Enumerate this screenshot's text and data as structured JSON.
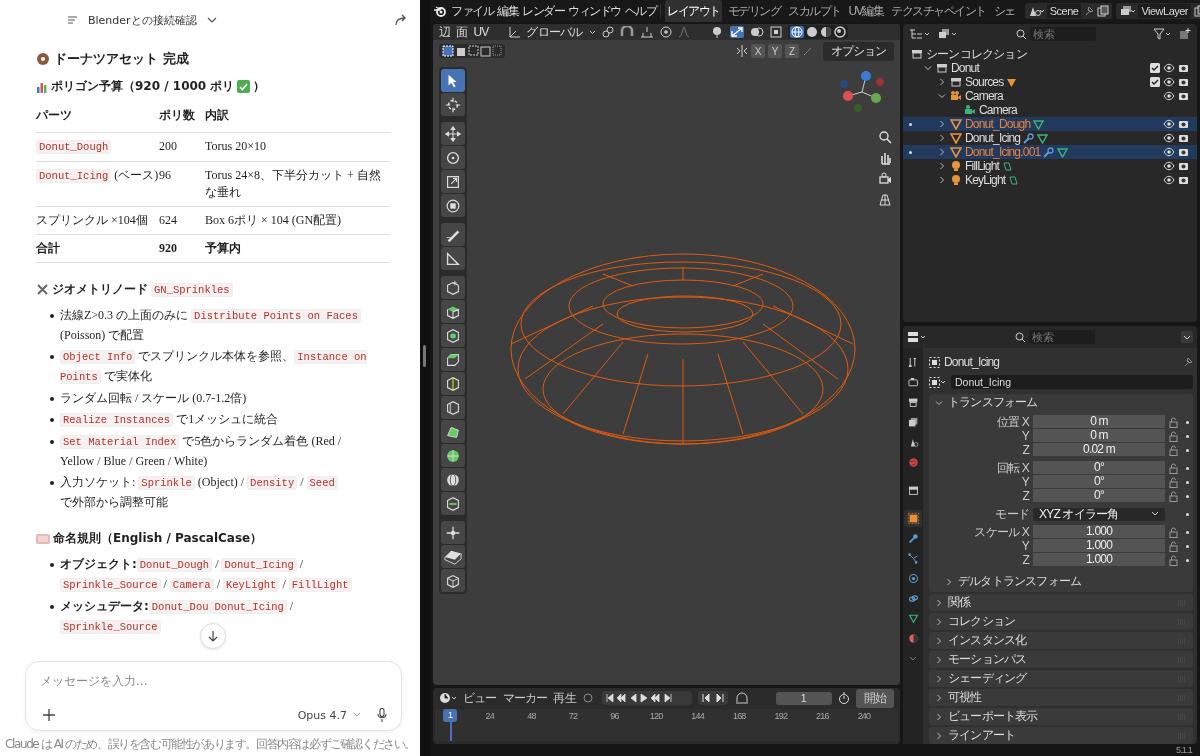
{
  "chat": {
    "title": "Blenderとの接続確認",
    "heading": "ドーナツアセット 完成",
    "budget": {
      "text": "ポリゴン予算（920 / 1000 ポリ",
      "text_after": "）"
    },
    "table": {
      "columns": [
        "パーツ",
        "ポリ数",
        "内訳"
      ],
      "rows": [
        {
          "bold": false,
          "cells": [
            [
              {
                "kind": "code",
                "text": "Donut_Dough"
              }
            ],
            [
              {
                "kind": "text",
                "text": "200"
              }
            ],
            [
              {
                "kind": "text",
                "text": "Torus 20×10"
              }
            ]
          ]
        },
        {
          "bold": false,
          "cells": [
            [
              {
                "kind": "code",
                "text": "Donut_Icing"
              },
              {
                "kind": "text",
                "text": " (ベース)"
              }
            ],
            [
              {
                "kind": "text",
                "text": "96"
              }
            ],
            [
              {
                "kind": "text",
                "text": "Torus 24×8、下半分カット + 自然な垂れ"
              }
            ]
          ]
        },
        {
          "bold": false,
          "cells": [
            [
              {
                "kind": "text",
                "text": "スプリンクル ×104個"
              }
            ],
            [
              {
                "kind": "text",
                "text": "624"
              }
            ],
            [
              {
                "kind": "text",
                "text": "Box 6ポリ × 104 (GN配置)"
              }
            ]
          ]
        },
        {
          "bold": true,
          "cells": [
            [
              {
                "kind": "text",
                "text": "合計"
              }
            ],
            [
              {
                "kind": "text",
                "text": "920"
              }
            ],
            [
              {
                "kind": "text",
                "text": "予算内"
              }
            ]
          ]
        }
      ]
    },
    "sections": [
      {
        "title": "ジオメトリノード",
        "title_code": "GN_Sprinkles",
        "items": [
          [
            {
              "kind": "text",
              "text": "法線Z>0.3 の上面のみに "
            },
            {
              "kind": "code",
              "text": "Distribute Points on Faces"
            },
            {
              "kind": "text",
              "text": " (Poisson) で配置"
            }
          ],
          [
            {
              "kind": "code",
              "text": "Object Info"
            },
            {
              "kind": "text",
              "text": " でスプリンクル本体を参照、"
            },
            {
              "kind": "code",
              "text": "Instance on Points"
            },
            {
              "kind": "text",
              "text": " で実体化"
            }
          ],
          [
            {
              "kind": "text",
              "text": "ランダム回転 / スケール (0.7-1.2倍)"
            }
          ],
          [
            {
              "kind": "code",
              "text": "Realize Instances"
            },
            {
              "kind": "text",
              "text": " で1メッシュに統合"
            }
          ],
          [
            {
              "kind": "code",
              "text": "Set Material Index"
            },
            {
              "kind": "text",
              "text": " で5色からランダム着色 (Red / Yellow / Blue / Green / White)"
            }
          ],
          [
            {
              "kind": "text",
              "text": "入力ソケット: "
            },
            {
              "kind": "code",
              "text": "Sprinkle"
            },
            {
              "kind": "text",
              "text": " (Object) / "
            },
            {
              "kind": "code",
              "text": "Density"
            },
            {
              "kind": "text",
              "text": " / "
            },
            {
              "kind": "code",
              "text": "Seed"
            },
            {
              "kind": "text",
              "text": " で外部から調整可能"
            }
          ]
        ]
      },
      {
        "title": "命名規則（English / PascalCase）",
        "items": [
          [
            {
              "kind": "bold",
              "text": "オブジェクト:"
            },
            {
              "kind": "code",
              "text": "Donut_Dough"
            },
            {
              "kind": "text",
              "text": " / "
            },
            {
              "kind": "code",
              "text": "Donut_Icing"
            },
            {
              "kind": "text",
              "text": " / "
            },
            {
              "kind": "code",
              "text": "Sprinkle_Source"
            },
            {
              "kind": "text",
              "text": " / "
            },
            {
              "kind": "code",
              "text": "Camera"
            },
            {
              "kind": "text",
              "text": " / "
            },
            {
              "kind": "code",
              "text": "KeyLight"
            },
            {
              "kind": "text",
              "text": " / "
            },
            {
              "kind": "code",
              "text": "FillLight"
            }
          ],
          [
            {
              "kind": "bold",
              "text": "メッシュデータ:"
            },
            {
              "kind": "code",
              "text": "Donut_Dou"
            },
            {
              "kind": "code",
              "text": "Donut_Icing"
            },
            {
              "kind": "text",
              "text": " / "
            },
            {
              "kind": "code",
              "text": "Sprinkle_Source"
            }
          ]
        ]
      }
    ],
    "input": {
      "placeholder": "メッセージを入力..."
    },
    "model": "Opus 4.7",
    "disclaimer": "Claude は AI のため、誤りを含む可能性があります。回答内容は必ずご確認ください。"
  },
  "blender": {
    "menus": [
      "ファイル",
      "編集",
      "レンダー",
      "ウィンドウ",
      "ヘルプ"
    ],
    "workspaces": [
      {
        "label": "レイアウト",
        "selected": true
      },
      {
        "label": "モデリング",
        "selected": false
      },
      {
        "label": "スカルプト",
        "selected": false
      },
      {
        "label": "UV編集",
        "selected": false
      },
      {
        "label": "テクスチャペイント",
        "selected": false
      },
      {
        "label": "シェ",
        "selected": false
      }
    ],
    "scene": "Scene",
    "view_layer": "ViewLayer",
    "viewport": {
      "select_modes": [
        "辺",
        "面",
        "UV"
      ],
      "orientation": "グローバル",
      "options": "オプション",
      "axes": [
        {
          "label": "X",
          "selected": false
        },
        {
          "label": "Y",
          "selected": false
        },
        {
          "label": "Z",
          "selected": false
        }
      ],
      "tools": [
        {
          "selected": true
        },
        {
          "selected": false
        },
        {
          "selected": false
        },
        {
          "selected": false
        },
        {
          "selected": false
        },
        {
          "selected": false
        },
        {
          "selected": false
        },
        {
          "selected": false
        },
        {
          "selected": false
        },
        {
          "selected": false
        },
        {
          "selected": false
        },
        {
          "selected": false
        },
        {
          "selected": false
        },
        {
          "selected": false
        },
        {
          "selected": false
        },
        {
          "selected": false
        },
        {
          "selected": false
        },
        {
          "selected": false
        },
        {
          "selected": false
        },
        {
          "selected": false
        },
        {
          "selected": false
        }
      ]
    },
    "outliner": {
      "search_placeholder": "検索",
      "root": "シーンコレクション",
      "tree": [
        {
          "name": "Donut",
          "kind": "collection",
          "selected": false,
          "expanded": true,
          "checked": true,
          "children": [
            {
              "name": "Sources",
              "kind": "collection",
              "selected": false,
              "expanded": false,
              "checked": true
            },
            {
              "name": "Camera",
              "kind": "camera",
              "selected": false,
              "expanded": true,
              "children": [
                {
                  "name": "Camera",
                  "kind": "camera_data",
                  "selected": false
                }
              ]
            },
            {
              "name": "Donut_Dough",
              "kind": "mesh",
              "selected": true,
              "expanded": false,
              "has_modifier": false
            },
            {
              "name": "Donut_Icing",
              "kind": "mesh",
              "selected": false,
              "expanded": false,
              "has_modifier": true
            },
            {
              "name": "Donut_Icing.001",
              "kind": "mesh",
              "selected": true,
              "expanded": false,
              "has_modifier": true
            },
            {
              "name": "FillLight",
              "kind": "light",
              "selected": false,
              "expanded": false
            },
            {
              "name": "KeyLight",
              "kind": "light",
              "selected": false,
              "expanded": false
            }
          ]
        }
      ]
    },
    "properties": {
      "search_placeholder": "検索",
      "tabs": [
        {
          "selected": false
        },
        {
          "selected": false
        },
        {
          "selected": false
        },
        {
          "selected": false
        },
        {
          "selected": false
        },
        {
          "selected": false
        },
        {
          "selected": false
        },
        {
          "selected": true
        },
        {
          "selected": false
        },
        {
          "selected": false
        },
        {
          "selected": false
        },
        {
          "selected": false
        },
        {
          "selected": false
        },
        {
          "selected": false
        }
      ],
      "object": "Donut_Icing",
      "object_field": "Donut_Icing",
      "transform": {
        "title": "トランスフォーム",
        "expanded": true,
        "groups": [
          {
            "rows": [
              {
                "label": "位置 X",
                "value": "0 m",
                "kind": "number"
              },
              {
                "label": "Y",
                "value": "0 m",
                "kind": "number"
              },
              {
                "label": "Z",
                "value": "0.02 m",
                "kind": "number"
              }
            ]
          },
          {
            "rows": [
              {
                "label": "回転 X",
                "value": "0°",
                "kind": "number"
              },
              {
                "label": "Y",
                "value": "0°",
                "kind": "number"
              },
              {
                "label": "Z",
                "value": "0°",
                "kind": "number"
              }
            ]
          },
          {
            "rows": [
              {
                "label": "モード",
                "value": "XYZ オイラー角",
                "kind": "dropdown"
              }
            ]
          },
          {
            "rows": [
              {
                "label": "スケール X",
                "value": "1.000",
                "kind": "number"
              },
              {
                "label": "Y",
                "value": "1.000",
                "kind": "number"
              },
              {
                "label": "Z",
                "value": "1.000",
                "kind": "number"
              }
            ]
          }
        ],
        "subpanel": {
          "title": "デルタトランスフォーム",
          "expanded": false
        }
      },
      "panels": [
        {
          "title": "関係",
          "expanded": false
        },
        {
          "title": "コレクション",
          "expanded": false
        },
        {
          "title": "インスタンス化",
          "expanded": false
        },
        {
          "title": "モーションパス",
          "expanded": false
        },
        {
          "title": "シェーディング",
          "expanded": false
        },
        {
          "title": "可視性",
          "expanded": false
        },
        {
          "title": "ビューポート表示",
          "expanded": false
        },
        {
          "title": "ラインアート",
          "expanded": false
        }
      ]
    },
    "timeline": {
      "menus": [
        "ビュー",
        "マーカー",
        "再生"
      ],
      "frame": "1",
      "start_label": "開始",
      "current_frame": "1",
      "ticks": [
        "24",
        "48",
        "72",
        "96",
        "120",
        "144",
        "168",
        "192",
        "216",
        "240"
      ]
    },
    "version": "5.1.1"
  }
}
